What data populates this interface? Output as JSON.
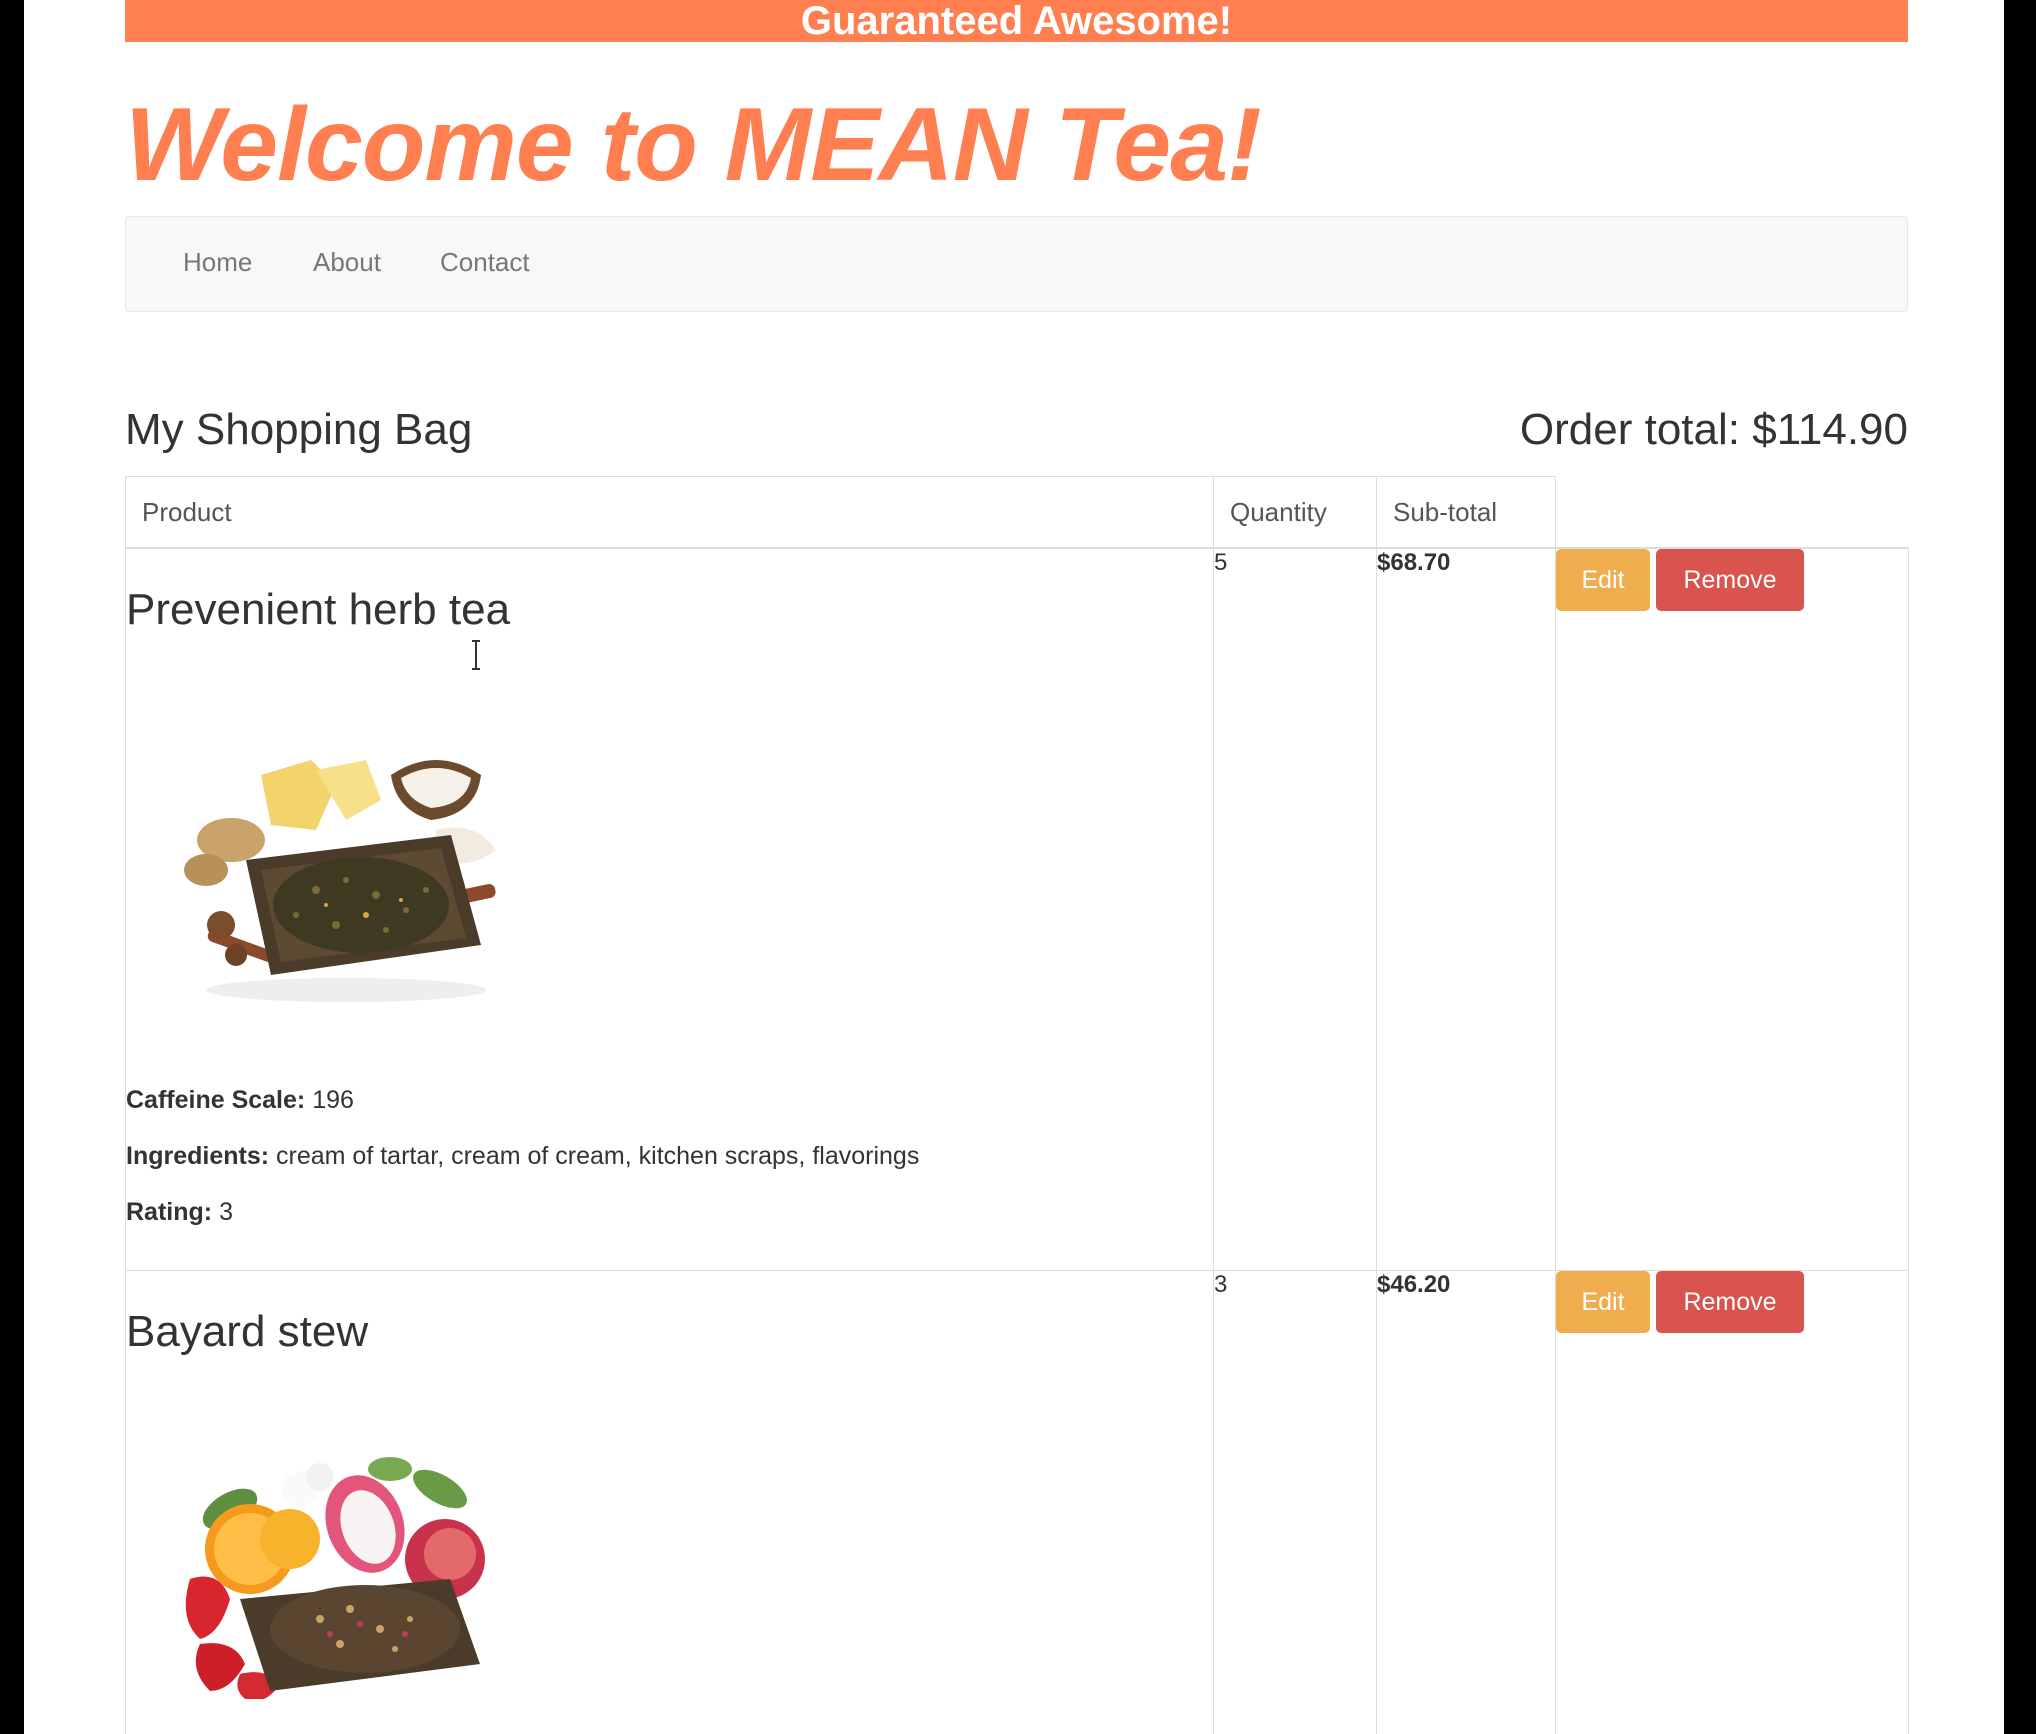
{
  "banner": {
    "text": "Guaranteed Awesome!"
  },
  "header": {
    "title": "Welcome to MEAN Tea!"
  },
  "nav": {
    "items": [
      "Home",
      "About",
      "Contact"
    ]
  },
  "bag": {
    "title": "My Shopping Bag",
    "order_total": "Order total: $114.90",
    "columns": [
      "Product",
      "Quantity",
      "Sub-total"
    ],
    "items": [
      {
        "name": "Prevenient herb tea",
        "caffeine_label": "Caffeine Scale:",
        "caffeine": "196",
        "ingredients_label": "Ingredients:",
        "ingredients": "cream of tartar, cream of cream, kitchen scraps, flavorings",
        "rating_label": "Rating:",
        "rating": "3",
        "quantity": "5",
        "subtotal": "$68.70",
        "edit": "Edit",
        "remove": "Remove"
      },
      {
        "name": "Bayard stew",
        "quantity": "3",
        "subtotal": "$46.20",
        "edit": "Edit",
        "remove": "Remove"
      }
    ]
  },
  "colors": {
    "brand_orange": "#ff7f50",
    "edit_button": "#f0ad4e",
    "remove_button": "#d9534f"
  }
}
